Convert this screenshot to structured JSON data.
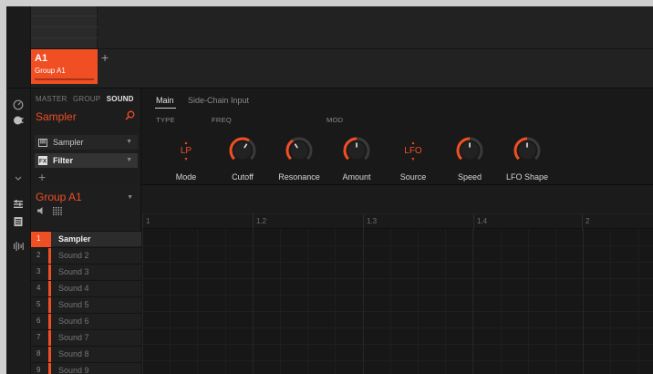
{
  "arranger": {
    "group_tile": {
      "name": "A1",
      "subtitle": "Group A1"
    },
    "add_symbol": "+"
  },
  "module": {
    "tabs": [
      {
        "label": "MASTER",
        "active": false
      },
      {
        "label": "GROUP",
        "active": false
      },
      {
        "label": "SOUND",
        "active": true
      }
    ],
    "plugin_title": "Sampler",
    "slots": [
      {
        "label": "Sampler",
        "icon": "keyboard-icon",
        "selected": false
      },
      {
        "label": "Filter",
        "icon": "fx-icon",
        "selected": true
      }
    ],
    "add_symbol": "+"
  },
  "params": {
    "tabs": [
      {
        "label": "Main",
        "active": true
      },
      {
        "label": "Side-Chain Input",
        "active": false
      }
    ],
    "sections": {
      "type": "TYPE",
      "freq": "FREQ",
      "mod": "MOD"
    },
    "controls": [
      {
        "label": "Mode",
        "kind": "selector",
        "value": "LP"
      },
      {
        "label": "Cutoff",
        "kind": "knob",
        "level": 0.62
      },
      {
        "label": "Resonance",
        "kind": "knob",
        "level": 0.38
      },
      {
        "label": "Amount",
        "kind": "knob",
        "level": 0.5
      },
      {
        "label": "Source",
        "kind": "selector",
        "value": "LFO"
      },
      {
        "label": "Speed",
        "kind": "knob",
        "level": 0.5
      },
      {
        "label": "LFO Shape",
        "kind": "knob",
        "level": 0.5
      }
    ]
  },
  "sounds": {
    "group_title": "Group A1",
    "items": [
      {
        "num": "1",
        "label": "Sampler",
        "selected": true
      },
      {
        "num": "2",
        "label": "Sound 2",
        "selected": false
      },
      {
        "num": "3",
        "label": "Sound 3",
        "selected": false
      },
      {
        "num": "4",
        "label": "Sound 4",
        "selected": false
      },
      {
        "num": "5",
        "label": "Sound 5",
        "selected": false
      },
      {
        "num": "6",
        "label": "Sound 6",
        "selected": false
      },
      {
        "num": "7",
        "label": "Sound 7",
        "selected": false
      },
      {
        "num": "8",
        "label": "Sound 8",
        "selected": false
      },
      {
        "num": "9",
        "label": "Sound 9",
        "selected": false
      }
    ]
  },
  "pattern": {
    "ruler_labels": [
      "1",
      "1.2",
      "1.3",
      "1.4",
      "2"
    ]
  },
  "colors": {
    "accent": "#f04e23",
    "background": "#161616",
    "panel": "#1d1d1d"
  }
}
